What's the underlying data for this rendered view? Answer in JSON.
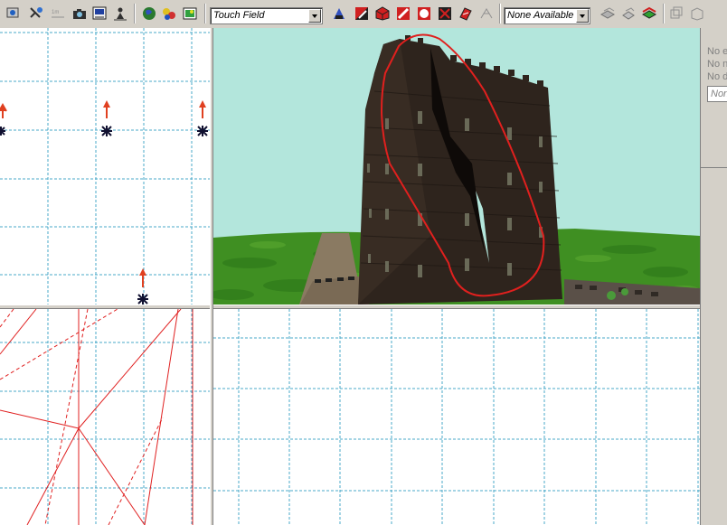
{
  "toolbar": {
    "touch_field_combo": "Touch Field",
    "none_available_combo": "None Available"
  },
  "properties_panel": {
    "line1": "No e",
    "line2": "No n",
    "line3": "No d",
    "field": "Non"
  },
  "icons": [
    "select-icon",
    "measure-icon",
    "camera-icon",
    "tools-icon",
    "person-icon",
    "globe-icon",
    "objects-icon",
    "image-icon",
    "shape-tool-icon",
    "paint-icon",
    "cube-icon",
    "sphere-icon",
    "transform-icon",
    "rotate-icon",
    "wireframe-icon",
    "layer-icon",
    "stack-icon",
    "copy-icon",
    "frame-icon"
  ],
  "colors": {
    "grid_line": "#4aa8c8",
    "sky": "#b3e6dc",
    "grass": "#3f8f22",
    "tower": "#2e241d",
    "annotation": "#e0201e",
    "wireframe": "#e02020"
  }
}
